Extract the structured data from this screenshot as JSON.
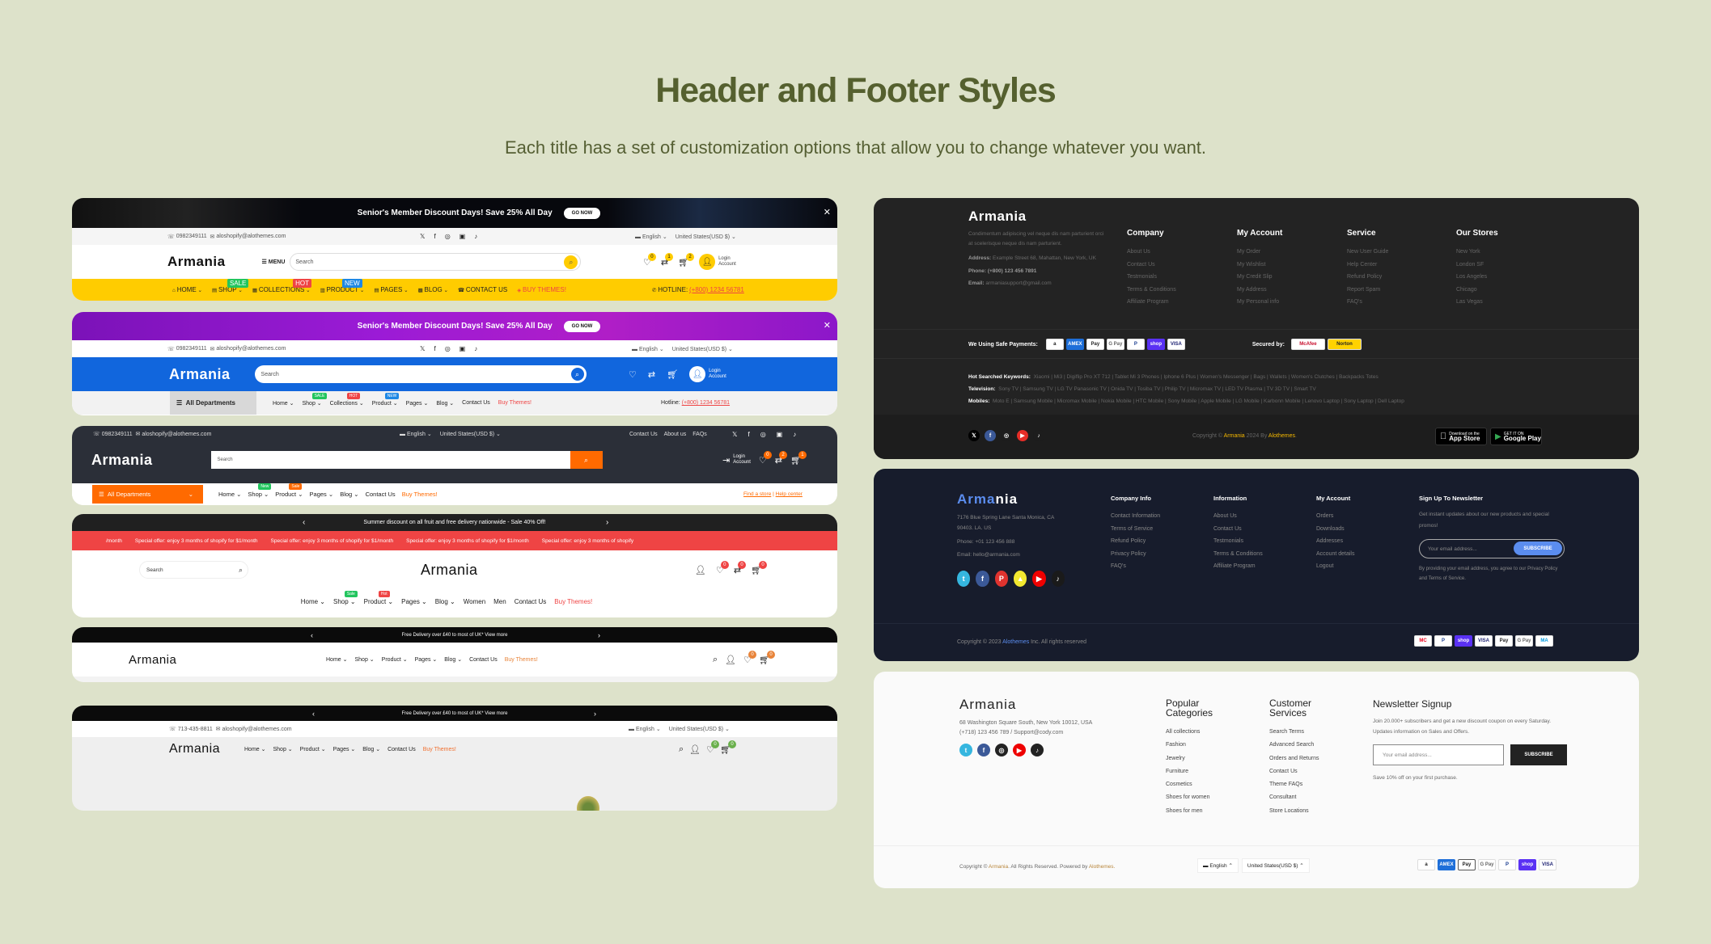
{
  "page": {
    "title": "Header and Footer Styles",
    "subtitle": "Each title has a set of customization options that allow you to change whatever you want."
  },
  "headers": [
    {
      "promo": "Senior's Member Discount Days! Save 25% All Day",
      "go_now": "GO NOW",
      "close": "✕",
      "phone": "0982349111",
      "email": "aloshopify@alothemes.com",
      "language": "English",
      "currency": "United States(USD $)",
      "logo": "Armania",
      "menu": "MENU",
      "search_placeholder": "Search",
      "login": "Login",
      "account": "Account",
      "badges": [
        "0",
        "1",
        "2"
      ],
      "nav": [
        "HOME",
        "SHOP",
        "COLLECTIONS",
        "PRODUCT",
        "PAGES",
        "BLOG",
        "CONTACT US",
        "BUY THEMES!"
      ],
      "tags": {
        "SHOP": "SALE",
        "COLLECTIONS": "HOT",
        "PRODUCT": "NEW"
      },
      "hotline_label": "HOTLINE:",
      "hotline": "(+800) 1234 56781"
    },
    {
      "promo": "Senior's Member Discount Days! Save 25% All Day",
      "go_now": "GO NOW",
      "close": "✕",
      "phone": "0982349111",
      "email": "aloshopify@alothemes.com",
      "language": "English",
      "currency": "United States(USD $)",
      "logo": "Armania",
      "search_placeholder": "Search",
      "login": "Login",
      "account": "Account",
      "departments": "All Departments",
      "nav": [
        "Home",
        "Shop",
        "Collections",
        "Product",
        "Pages",
        "Blog",
        "Contact Us",
        "Buy Themes!"
      ],
      "tags": {
        "Shop": "SALE",
        "Collections": "HOT",
        "Product": "NEW"
      },
      "hotline_label": "Hotline:",
      "hotline": "(+800) 1234 56781"
    },
    {
      "phone": "0982349111",
      "email": "aloshopify@alothemes.com",
      "language": "English",
      "currency": "United States(USD $)",
      "top_links": [
        "Contact Us",
        "About us",
        "FAQs"
      ],
      "logo": "Armania",
      "search_placeholder": "Search",
      "login": "Login",
      "account": "Account",
      "badges": [
        "0",
        "2",
        "1"
      ],
      "departments": "All Departments",
      "nav": [
        "Home",
        "Shop",
        "Product",
        "Pages",
        "Blog",
        "Contact Us",
        "Buy Themes!"
      ],
      "tags": {
        "Shop": "New",
        "Product": "Sale"
      },
      "find_store": "Find a store",
      "help_center": "Help center"
    },
    {
      "announcement": "Summer discount on all fruit and free delivery nationwide - Sale 40% Off!",
      "marquee": [
        "/month",
        "Special offer: enjoy 3 months of shopify for $1/month",
        "Special offer: enjoy 3 months of shopify for $1/month",
        "Special offer: enjoy 3 months of shopify for $1/month",
        "Special offer: enjoy 3 months of shopify"
      ],
      "search_placeholder": "Search",
      "logo": "Armania",
      "badges": [
        "0",
        "0",
        "0"
      ],
      "nav": [
        "Home",
        "Shop",
        "Product",
        "Pages",
        "Blog",
        "Women",
        "Men",
        "Contact Us",
        "Buy Themes!"
      ],
      "tags": {
        "Shop": "Sale",
        "Product": "Hot"
      }
    },
    {
      "announcement": "Free Delivery over £40 to most of UK* View more",
      "logo": "Armania",
      "nav": [
        "Home",
        "Shop",
        "Product",
        "Pages",
        "Blog",
        "Contact Us",
        "Buy Themes!"
      ],
      "badges": [
        "0",
        "0"
      ]
    },
    {
      "announcement": "Free Delivery over £40 to most of UK* View more",
      "phone": "713-435-8811",
      "email": "aloshopify@alothemes.com",
      "language": "English",
      "currency": "United States(USD $)",
      "logo": "Armania",
      "nav": [
        "Home",
        "Shop",
        "Product",
        "Pages",
        "Blog",
        "Contact Us",
        "Buy Themes!"
      ],
      "badges": [
        "0",
        "0"
      ]
    }
  ],
  "footer1": {
    "logo": "Armania",
    "desc": "Condimentum adipiscing vel neque dis nam parturient orci at scelerisque neque dis nam parturient.",
    "address_label": "Address:",
    "address": "Example Street 68, Mahattan, New York, UK",
    "phone": "Phone: (+800) 123 456 7891",
    "email_label": "Email:",
    "email": "armaniasupport@gmail.com",
    "columns": [
      {
        "title": "Company",
        "links": [
          "About Us",
          "Contact Us",
          "Testmonials",
          "Terms & Conditions",
          "Affiliate Program"
        ]
      },
      {
        "title": "My Account",
        "links": [
          "My Order",
          "My Wishlist",
          "My Credit Slip",
          "My Address",
          "My Personal info"
        ]
      },
      {
        "title": "Service",
        "links": [
          "New User Guide",
          "Help Center",
          "Refund Policy",
          "Report Spam",
          "FAQ's"
        ]
      },
      {
        "title": "Our Stores",
        "links": [
          "New York",
          "London SF",
          "Los Angeles",
          "Chicago",
          "Las Vegas"
        ]
      }
    ],
    "payments_label": "We Using Safe Payments:",
    "payments": [
      "a",
      "AMEX",
      "Pay",
      "G Pay",
      "P",
      "shop",
      "VISA"
    ],
    "secured_label": "Secured by:",
    "secured": [
      "McAfee",
      "Norton"
    ],
    "keywords": [
      {
        "label": "Hot Searched Keywords:",
        "items": "Xiaomi | Mi3 | Digiflip Pro XT 712 | Tablet Mi 3 Phones | Iphone 6 Plus | Women's Messenger | Bags | Wallets | Women's Clutches | Backpacks Totes"
      },
      {
        "label": "Television:",
        "items": "Sony TV | Samsung TV | LG TV Panasonic TV | Onida TV | Tosiba TV | Philip TV | Micromax TV | LED TV Plasma | TV 3D TV | Smart TV"
      },
      {
        "label": "Mobiles:",
        "items": "Moto E | Samsung Mobile | Micromax Mobile | Nokia Mobile | HTC Mobile | Sony Mobile | Apple Mobile | LG Mobile | Karbonn Mobile | Lenovo Laptop | Sony Laptop | Dell Laptop"
      }
    ],
    "copyright_pre": "Copyright ©",
    "copyright_brand": "Armania",
    "copyright_mid": "2024 By",
    "copyright_by": "Alothemes",
    "app_store_small": "Download on the",
    "app_store": "App Store",
    "google_play_small": "GET IT ON",
    "google_play": "Google Play"
  },
  "footer2": {
    "logo_a": "Arma",
    "logo_b": "nia",
    "address": "7176 Blue Spring Lane Santa Monica, CA 90403. LA. US",
    "phone": "Phone: +01 123 456 888",
    "email": "Email: hello@armania.com",
    "columns": [
      {
        "title": "Company Info",
        "links": [
          "Contact Information",
          "Terms of Service",
          "Refund Policy",
          "Privacy Policy",
          "FAQ's"
        ]
      },
      {
        "title": "Information",
        "links": [
          "About Us",
          "Contact Us",
          "Testmonials",
          "Terms & Conditions",
          "Affiliate Program"
        ]
      },
      {
        "title": "My Account",
        "links": [
          "Orders",
          "Downloads",
          "Addresses",
          "Account details",
          "Logout"
        ]
      }
    ],
    "newsletter_title": "Sign Up To Newsletter",
    "newsletter_desc": "Get instant updates about our new products and special promos!",
    "email_placeholder": "Your email address...",
    "subscribe": "SUBSCRIBE",
    "consent": "By providing your email address, you agree to our Privacy Policy and Terms of Service.",
    "copyright_pre": "Copyright © 2023",
    "copyright_brand": "Alothemes",
    "copyright_post": "Inc. All rights reserved",
    "payments": [
      "MC",
      "P",
      "shop",
      "VISA",
      "Pay",
      "G Pay",
      "MA"
    ]
  },
  "footer3": {
    "logo": "Armania",
    "address": "68 Washington Square South, New York 10012, USA",
    "contact": "(+718) 123 456 789 / Support@cody.com",
    "columns": [
      {
        "title": "Popular Categories",
        "links": [
          "All collections",
          "Fashion",
          "Jewelry",
          "Furniture",
          "Cosmetics",
          "Shoes for women",
          "Shoes for men"
        ]
      },
      {
        "title": "Customer Services",
        "links": [
          "Search Terms",
          "Advanced Search",
          "Orders and Returns",
          "Contact Us",
          "Theme FAQs",
          "Consultant",
          "Store Locations"
        ]
      }
    ],
    "newsletter_title": "Newsletter Signup",
    "newsletter_desc": "Join 20.000+ subscribers and get a new discount coupon on every Saturday. Updates information on Sales and Offers.",
    "email_placeholder": "Your email address...",
    "subscribe": "SUBSCRIBE",
    "save_note": "Save 10% off on your first purchase.",
    "copyright_pre": "Copyright ©",
    "copyright_brand": "Armania",
    "copyright_mid": ". All Rights Reserved. Powered by",
    "copyright_by": "Alothemes.",
    "language": "English",
    "currency": "United States(USD $)",
    "payments": [
      "a",
      "AMEX",
      "Pay",
      "G Pay",
      "P",
      "shop",
      "VISA"
    ]
  },
  "colors": {
    "background": "#dde2ca",
    "title": "#55602f",
    "yellow": "#ffcc00",
    "blue": "#1166dd",
    "orange": "#ff6a00",
    "red": "#ef4444",
    "dark_footer": "#232323",
    "navy_footer": "#171c2c"
  }
}
